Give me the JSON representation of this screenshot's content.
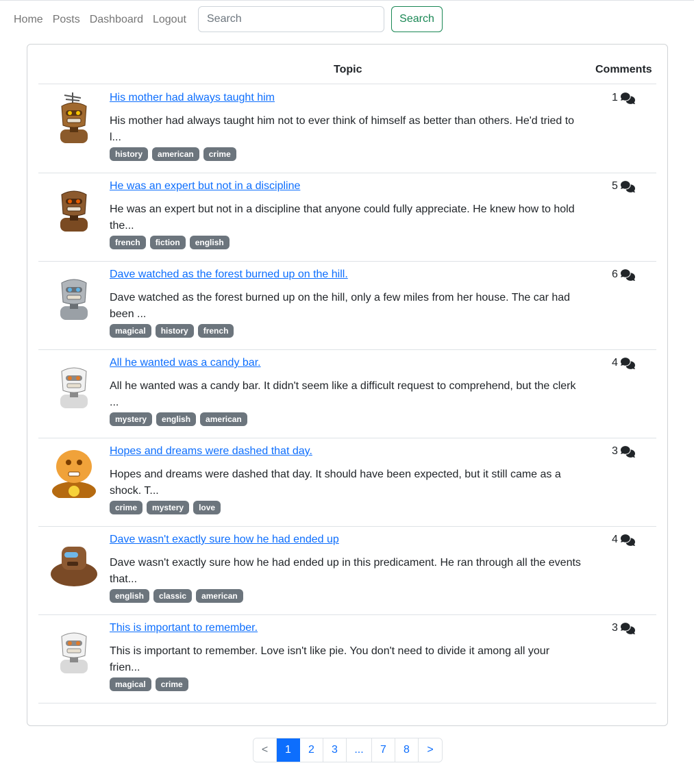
{
  "nav": {
    "links": [
      "Home",
      "Posts",
      "Dashboard",
      "Logout"
    ],
    "search_placeholder": "Search",
    "search_button": "Search"
  },
  "table": {
    "headers": {
      "topic": "Topic",
      "comments": "Comments"
    },
    "rows": [
      {
        "avatar": "robot-antenna-icon",
        "title": "His mother had always taught him",
        "excerpt": "His mother had always taught him not to ever think of himself as better than others. He'd tried to l...",
        "tags": [
          "history",
          "american",
          "crime"
        ],
        "comments": "1"
      },
      {
        "avatar": "robot-brown-icon",
        "title": "He was an expert but not in a discipline",
        "excerpt": "He was an expert but not in a discipline that anyone could fully appreciate. He knew how to hold the...",
        "tags": [
          "french",
          "fiction",
          "english"
        ],
        "comments": "5"
      },
      {
        "avatar": "robot-grey-icon",
        "title": "Dave watched as the forest burned up on the hill.",
        "excerpt": "Dave watched as the forest burned up on the hill, only a few miles from her house. The car had been ...",
        "tags": [
          "magical",
          "history",
          "french"
        ],
        "comments": "6"
      },
      {
        "avatar": "robot-white-icon",
        "title": "All he wanted was a candy bar.",
        "excerpt": "All he wanted was a candy bar. It didn't seem like a difficult request to comprehend, but the clerk ...",
        "tags": [
          "mystery",
          "english",
          "american"
        ],
        "comments": "4"
      },
      {
        "avatar": "robot-orange-icon",
        "title": "Hopes and dreams were dashed that day.",
        "excerpt": "Hopes and dreams were dashed that day. It should have been expected, but it still came as a shock. T...",
        "tags": [
          "crime",
          "mystery",
          "love"
        ],
        "comments": "3"
      },
      {
        "avatar": "robot-wide-icon",
        "title": "Dave wasn't exactly sure how he had ended up",
        "excerpt": "Dave wasn't exactly sure how he had ended up in this predicament. He ran through all the events that...",
        "tags": [
          "english",
          "classic",
          "american"
        ],
        "comments": "4"
      },
      {
        "avatar": "robot-white-icon",
        "title": "This is important to remember.",
        "excerpt": "This is important to remember. Love isn't like pie. You don't need to divide it among all your frien...",
        "tags": [
          "magical",
          "crime"
        ],
        "comments": "3"
      }
    ]
  },
  "pagination": {
    "pages": [
      "<",
      "1",
      "2",
      "3",
      "...",
      "7",
      "8",
      ">"
    ],
    "active": "1"
  },
  "colors": {
    "link": "#0d6efd",
    "tag": "#6c757d",
    "search_button": "#198754",
    "active_page": "#0d6efd"
  }
}
